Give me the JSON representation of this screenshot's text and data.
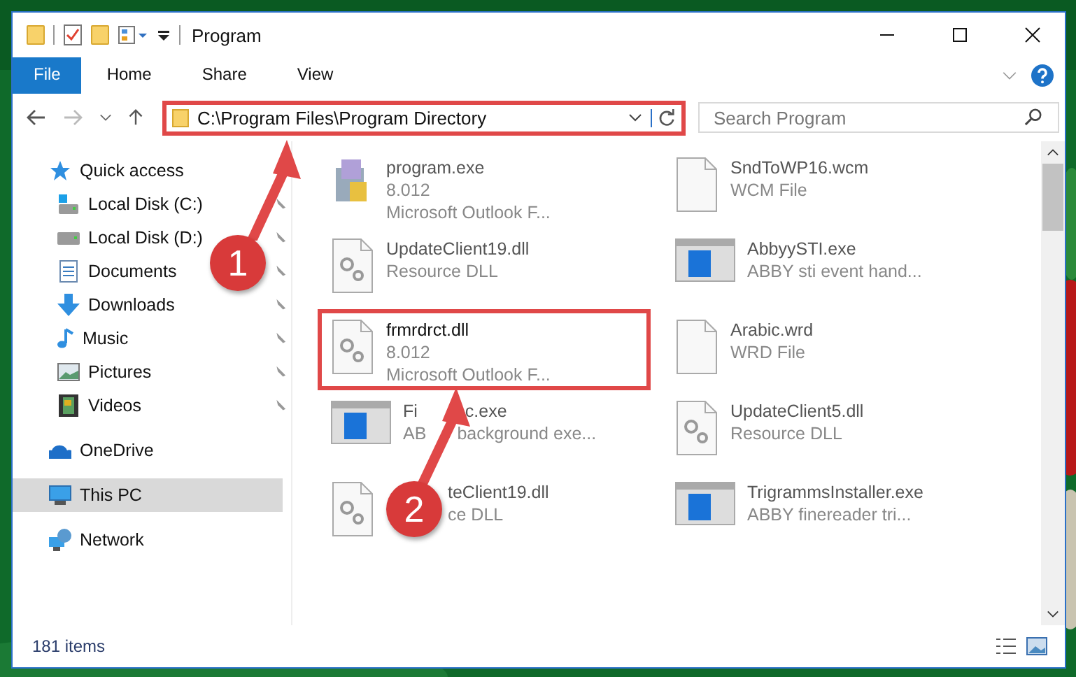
{
  "window": {
    "title": "Program"
  },
  "ribbon": {
    "tabs": [
      {
        "label": "File",
        "kind": "file",
        "selected": false
      },
      {
        "label": "Home",
        "kind": "tab",
        "selected": false
      },
      {
        "label": "Share",
        "kind": "tab",
        "selected": false
      },
      {
        "label": "View",
        "kind": "tab",
        "selected": false
      }
    ]
  },
  "address": {
    "value": "C:\\Program Files\\Program Directory",
    "highlighted": true
  },
  "search": {
    "placeholder": "Search Program"
  },
  "sidebar": {
    "items": [
      {
        "label": "Quick access",
        "selected": false,
        "children": [
          {
            "label": "Local Disk (C:)",
            "pinned": true,
            "selected": false
          },
          {
            "label": "Local Disk (D:)",
            "pinned": true,
            "selected": false
          },
          {
            "label": "Documents",
            "pinned": true,
            "selected": false
          },
          {
            "label": "Downloads",
            "pinned": true,
            "selected": false
          },
          {
            "label": "Music",
            "pinned": true,
            "selected": false
          },
          {
            "label": "Pictures",
            "pinned": true,
            "selected": false
          },
          {
            "label": "Videos",
            "pinned": true,
            "selected": false
          }
        ]
      },
      {
        "label": "OneDrive",
        "selected": false
      },
      {
        "label": "This PC",
        "selected": true
      },
      {
        "label": "Network",
        "selected": false
      }
    ]
  },
  "files": [
    {
      "name": "program.exe",
      "lines": [
        "8.012",
        "Microsoft Outlook F..."
      ],
      "kind": "program",
      "highlighted": false
    },
    {
      "name": "SndToWP16.wcm",
      "lines": [
        "WCM File"
      ],
      "kind": "blank",
      "highlighted": false
    },
    {
      "name": "UpdateClient19.dll",
      "lines": [
        "Resource DLL"
      ],
      "kind": "dll",
      "highlighted": false
    },
    {
      "name": "AbbyySTI.exe",
      "lines": [
        "ABBY sti event hand..."
      ],
      "kind": "app",
      "highlighted": false
    },
    {
      "name": "frmrdrct.dll",
      "lines": [
        "8.012",
        "Microsoft Outlook F..."
      ],
      "kind": "dll",
      "highlighted": true
    },
    {
      "name": "Arabic.wrd",
      "lines": [
        "WRD File"
      ],
      "kind": "blank",
      "highlighted": false
    },
    {
      "name": "Fi",
      "name_tail": "c.exe",
      "lines": [
        "AB"
      ],
      "lines_tail": [
        "background exe..."
      ],
      "kind": "app",
      "highlighted": false
    },
    {
      "name": "UpdateClient5.dll",
      "lines": [
        "Resource DLL"
      ],
      "kind": "dll",
      "highlighted": false
    },
    {
      "name": "teClient19.dll",
      "lines": [
        "ce DLL"
      ],
      "kind": "dll",
      "highlighted": false
    },
    {
      "name": "TrigrammsInstaller.exe",
      "lines": [
        "ABBY finereader tri..."
      ],
      "kind": "app",
      "highlighted": false
    }
  ],
  "status_bar": {
    "count": "181 items"
  },
  "annotations": [
    {
      "label": "1"
    },
    {
      "label": "2"
    }
  ]
}
